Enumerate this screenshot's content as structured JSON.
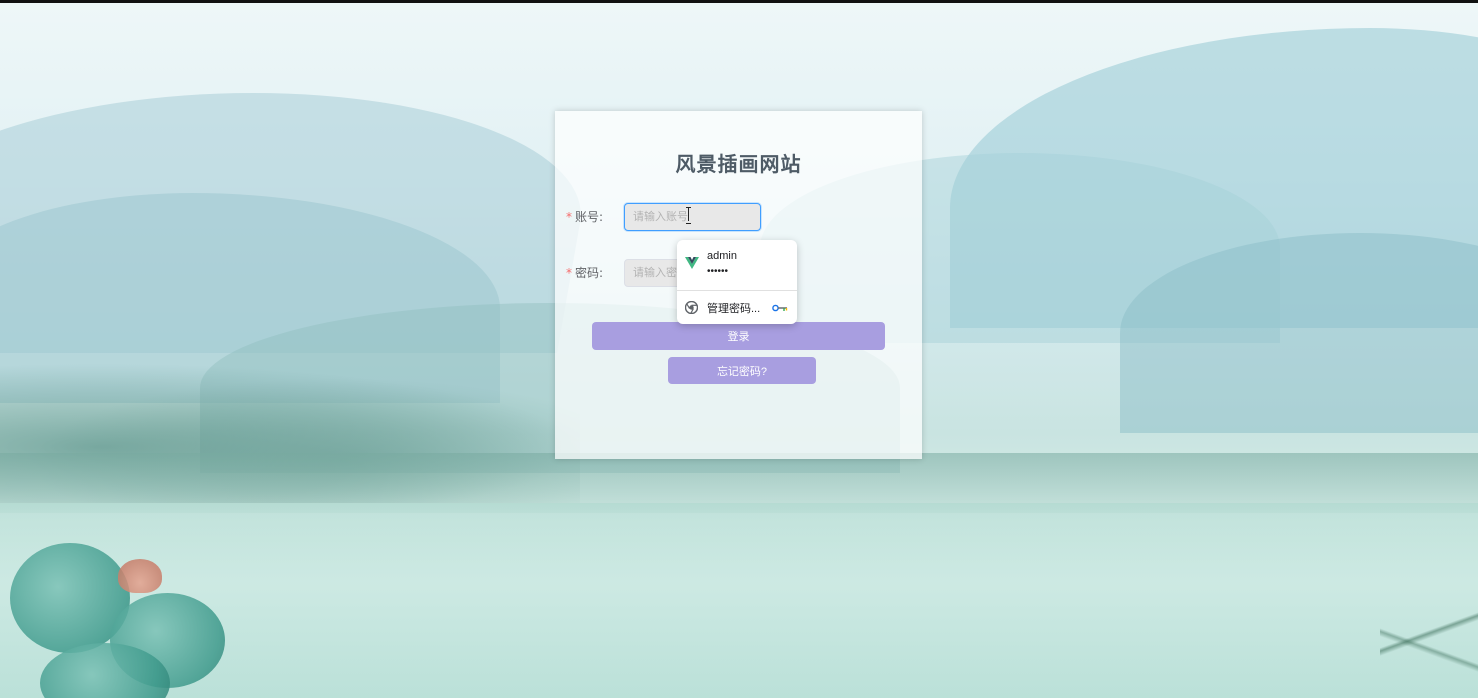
{
  "site": {
    "title": "风景插画网站"
  },
  "form": {
    "account": {
      "label": "账号:",
      "required_mark": "*",
      "placeholder": "请输入账号",
      "value": ""
    },
    "password": {
      "label": "密码:",
      "required_mark": "*",
      "placeholder": "请输入密码",
      "value": ""
    },
    "login_button": "登录",
    "forgot_button": "忘记密码?"
  },
  "autofill_popup": {
    "credential": {
      "username": "admin",
      "password_mask": "••••••",
      "icon": "vue-logo-icon"
    },
    "manage": {
      "label": "管理密码...",
      "icon": "chrome-icon",
      "action_icon": "key-icon"
    }
  },
  "colors": {
    "accent_button": "#a89ee0",
    "focus_border": "#409eff",
    "required": "#f56c6c"
  }
}
